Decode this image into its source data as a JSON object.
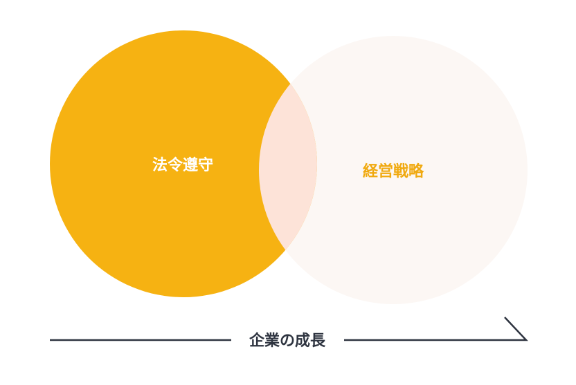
{
  "colors": {
    "circle_left": "#F6B212",
    "circle_right": "#FCF7F4",
    "overlap": "#FDE3D8",
    "label_left": "#FFFFFF",
    "label_right": "#F0A90F",
    "axis": "#2E3440"
  },
  "circles": {
    "left_label": "法令遵守",
    "right_label": "経営戦略"
  },
  "axis": {
    "label": "企業の成長"
  }
}
